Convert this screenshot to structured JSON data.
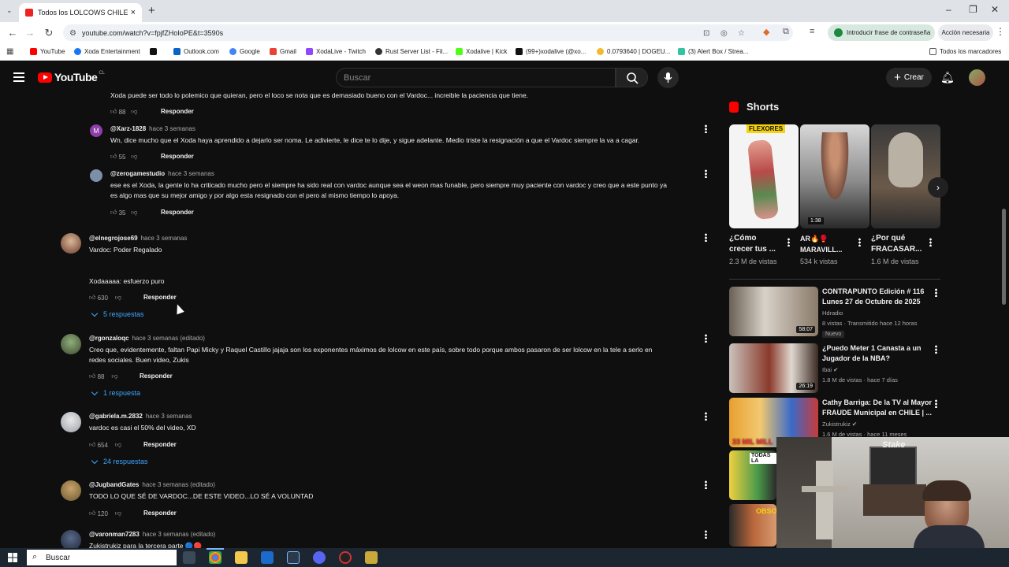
{
  "browser": {
    "tab_title": "Todos los LOLCOWS CHILENOS",
    "url": "youtube.com/watch?v=fpjfZHoIoPE&t=3590s",
    "password_button": "Introducir frase de contraseña",
    "action_button": "Acción necesaria",
    "all_bookmarks": "Todos los marcadores",
    "bookmarks": [
      "YouTube",
      "Xoda Entertainment",
      "",
      "Outlook.com",
      "Google",
      "Gmail",
      "XodaLive - Twitch",
      "Rust Server List - Fil...",
      "Xodalive | Kick",
      "(99+)xodalive (@xo...",
      "0.0793640 | DOGEU...",
      "(3) Alert Box / Strea..."
    ]
  },
  "youtube": {
    "logo_text": "YouTube",
    "country": "CL",
    "search_placeholder": "Buscar",
    "create_label": "Crear"
  },
  "comments": [
    {
      "text": "Xoda puede ser todo lo polemico que quieran, pero el loco se nota que es demasiado bueno con el Vardoc... increible la paciencia que tiene.",
      "likes": "88",
      "reply": "Responder"
    },
    {
      "user": "@Xarz-1828",
      "time": "hace 3 semanas",
      "text": "Wn, dice mucho que el Xoda haya aprendido a dejarlo ser noma. Le adivierte, le dice te lo dije, y sigue adelante. Medio triste la resignación a que el Vardoc siempre la va a cagar.",
      "likes": "55",
      "reply": "Responder"
    },
    {
      "user": "@zerogamestudio",
      "time": "hace 3 semanas",
      "text1": "ese es el Xoda, la gente lo ha criticado mucho pero el siempre ha sido real con vardoc aunque sea el weon mas funable, pero siempre muy paciente con vardoc y creo que a este punto ya",
      "text2": "es algo mas que su mejor amigo y por algo esta resignado con el pero al mismo tiempo lo apoya.",
      "likes": "35",
      "reply": "Responder"
    },
    {
      "user": "@elnegrojose69",
      "time": "hace 3 semanas",
      "text1": "Vardoc: Poder Regalado",
      "text2": "Xodaaaaa: esfuerzo puro",
      "likes": "630",
      "reply": "Responder",
      "replies": "5 respuestas"
    },
    {
      "user": "@rgonzaloqc",
      "time": "hace 3 semanas (editado)",
      "text1": "Creo que, evidentemente, faltan Papi Micky y Raquel Castillo jajaja son los exponentes máximos de lolcow en este país, sobre todo porque ambos pasaron de ser lolcow en la tele a serlo en",
      "text2": "redes sociales. Buen video, Zukis",
      "likes": "88",
      "reply": "Responder",
      "replies": "1 respuesta"
    },
    {
      "user": "@gabriela.m.2832",
      "time": "hace 3 semanas",
      "text": "vardoc es casi el 50% del video, XD",
      "likes": "654",
      "reply": "Responder",
      "replies": "24 respuestas"
    },
    {
      "user": "@JugbandGates",
      "time": "hace 3 semanas (editado)",
      "text": "TODO LO QUE SÉ DE VARDOC...DE ESTE VIDEO...LO SÉ A VOLUNTAD",
      "likes": "120",
      "reply": "Responder"
    },
    {
      "user": "@varonman7283",
      "time": "hace 3 semanas (editado)",
      "text": "Zukistrukiz para la tercera parte 🔵🔴"
    }
  ],
  "sidebar": {
    "shorts_heading": "Shorts",
    "shorts": [
      {
        "title1": "¿Cómo",
        "title2": "crecer tus ...",
        "views": "2.3 M de vistas",
        "overlay": "FLEXORES"
      },
      {
        "title1": "AR🔥🥊",
        "title2": "MARAVILL...",
        "views": "534 k vistas",
        "overlay": "1:38"
      },
      {
        "title1": "¿Por qué",
        "title2": "FRACASAR...",
        "views": "1.6 M de vistas"
      }
    ],
    "videos": [
      {
        "title1": "CONTRAPUNTO Edición  # 116",
        "title2": "Lunes 27 de Octubre de  2025",
        "channel": "Hdradio",
        "meta": "8 vistas · Transmitido hace 12 horas",
        "badge": "Nuevo",
        "duration": "58:07"
      },
      {
        "title1": "¿Puedo Meter 1 Canasta a un",
        "title2": "Jugador de la NBA?",
        "channel": "Ibai ✔",
        "meta": "1.8 M de vistas · hace 7 días",
        "duration": "26:19"
      },
      {
        "title1": "Cathy Barriga: De la TV al Mayor",
        "title2": "FRAUDE Municipal en CHILE | ...",
        "channel": "Zukistrukiz ✔",
        "meta": "1.6 M de vistas · hace 11 meses",
        "overlay": "33 MIL MILL"
      },
      {
        "overlay": "TODAS LA"
      },
      {
        "overlay": "OBSO"
      }
    ]
  },
  "webcam": {
    "watermark": "Stake"
  },
  "taskbar": {
    "search_placeholder": "Buscar"
  }
}
